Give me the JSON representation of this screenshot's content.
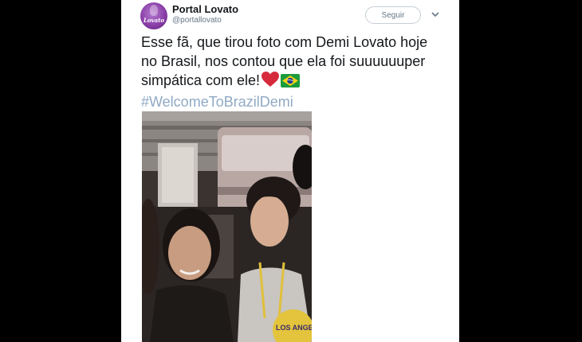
{
  "account": {
    "display_name": "Portal Lovato",
    "handle": "@portallovato",
    "avatar_text": "Lovato"
  },
  "follow_button": {
    "label": "Seguir"
  },
  "tweet": {
    "lines": [
      "Esse fã, que tirou foto com Demi Lovato hoje",
      "no Brasil, nos contou que ela foi suuuuuuper",
      "simpática com ele!"
    ],
    "emojis": [
      "red-heart",
      "brazil-flag"
    ],
    "hashtag": "#WelcomeToBrazilDemi"
  },
  "photo": {
    "shirt_text": "LOS ANGE",
    "icon": "photo-of-two-people"
  },
  "colors": {
    "background": "#000000",
    "card": "#ffffff",
    "hashtag": "#8fa9c4",
    "brand_purple": "#8a3fa8"
  }
}
